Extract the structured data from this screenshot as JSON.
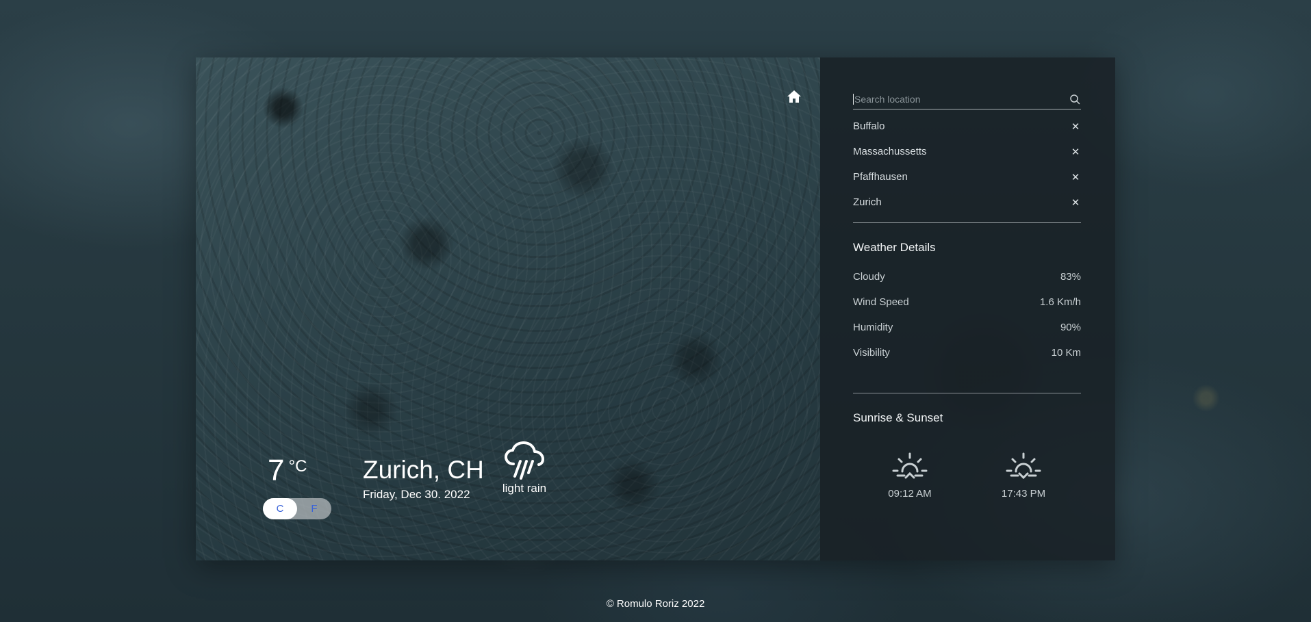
{
  "main": {
    "temperature": "7",
    "temperature_unit": "°C",
    "unit_toggle": {
      "celsius": "C",
      "fahrenheit": "F"
    },
    "location": "Zurich, CH",
    "date": "Friday, Dec 30. 2022",
    "condition": "light rain",
    "condition_icon": "cloud-rain-icon",
    "home_icon": "home-icon"
  },
  "sidebar": {
    "search": {
      "placeholder": "Search location",
      "value": ""
    },
    "locations": [
      {
        "name": "Buffalo"
      },
      {
        "name": "Massachussetts"
      },
      {
        "name": "Pfaffhausen"
      },
      {
        "name": "Zurich"
      }
    ],
    "weather_details": {
      "title": "Weather Details",
      "items": [
        {
          "label": "Cloudy",
          "value": "83%"
        },
        {
          "label": "Wind Speed",
          "value": "1.6 Km/h"
        },
        {
          "label": "Humidity",
          "value": "90%"
        },
        {
          "label": "Visibility",
          "value": "10 Km"
        }
      ]
    },
    "sun": {
      "title": "Sunrise & Sunset",
      "sunrise": "09:12 AM",
      "sunset": "17:43 PM"
    }
  },
  "footer": {
    "text": "© Romulo Roriz 2022"
  },
  "colors": {
    "accent": "#3a63d8",
    "panel": "#182024",
    "text": "#e8ecee"
  }
}
